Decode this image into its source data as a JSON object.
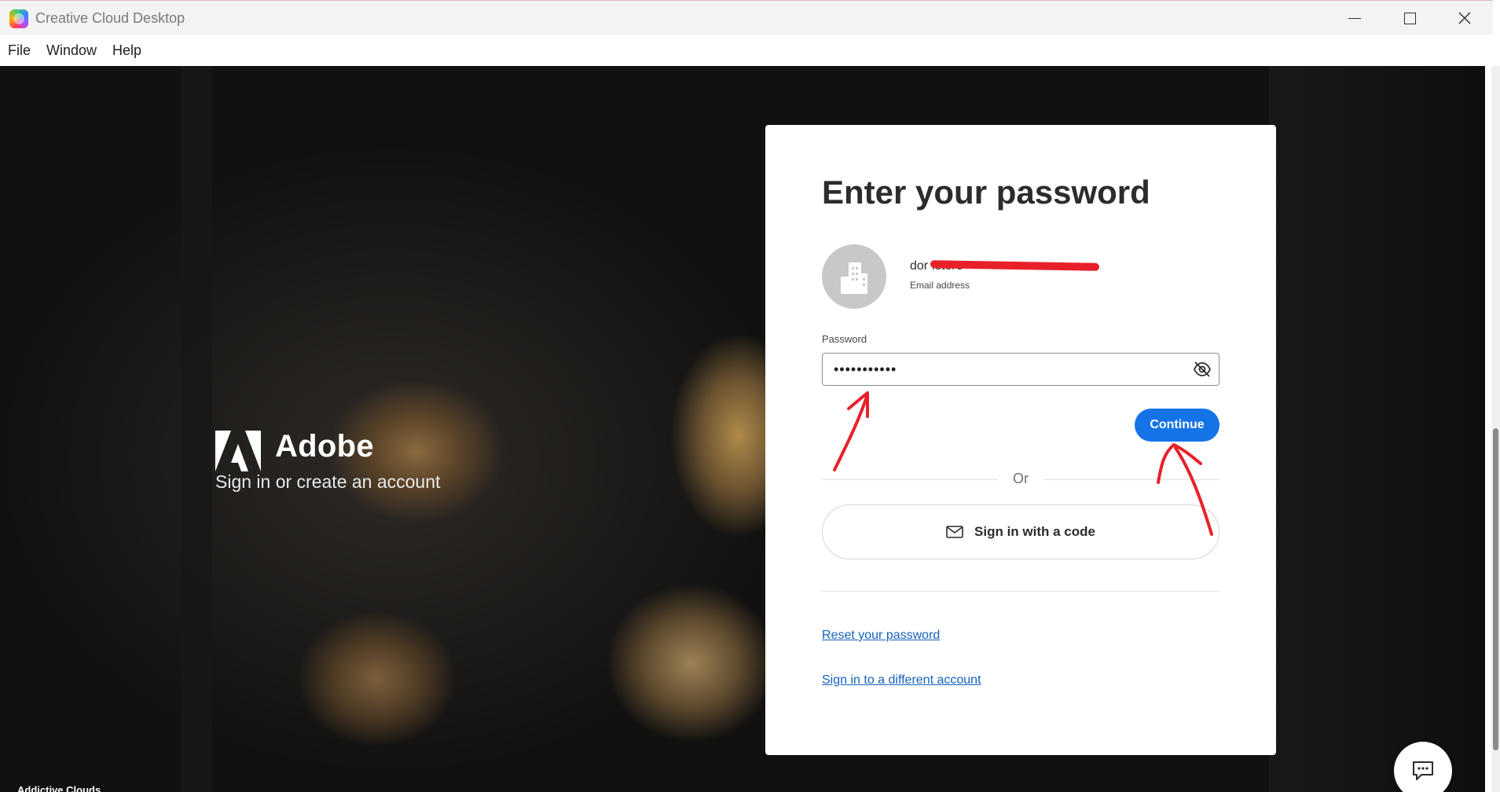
{
  "window": {
    "title": "Creative Cloud Desktop"
  },
  "menu": {
    "items": [
      "File",
      "Window",
      "Help"
    ]
  },
  "brand": {
    "name": "Adobe",
    "tagline": "Sign in or create an account"
  },
  "card": {
    "title": "Enter your password",
    "email_visible_text": "dor                                              .store",
    "email_label": "Email address",
    "password_label": "Password",
    "password_value": "•••••••••••",
    "continue_label": "Continue",
    "or_text": "Or",
    "sign_in_code_label": "Sign in with a code",
    "reset_link": "Reset your password",
    "different_account_link": "Sign in to a different account"
  },
  "bottom_label": "Addictive Clouds",
  "colors": {
    "accent": "#1473e6",
    "link": "#1461bd",
    "annotation": "#e8202a"
  },
  "icons": [
    "creative-cloud-icon",
    "adobe-logo-icon",
    "building-avatar-icon",
    "eye-slash-icon",
    "mail-icon",
    "chat-icon"
  ]
}
